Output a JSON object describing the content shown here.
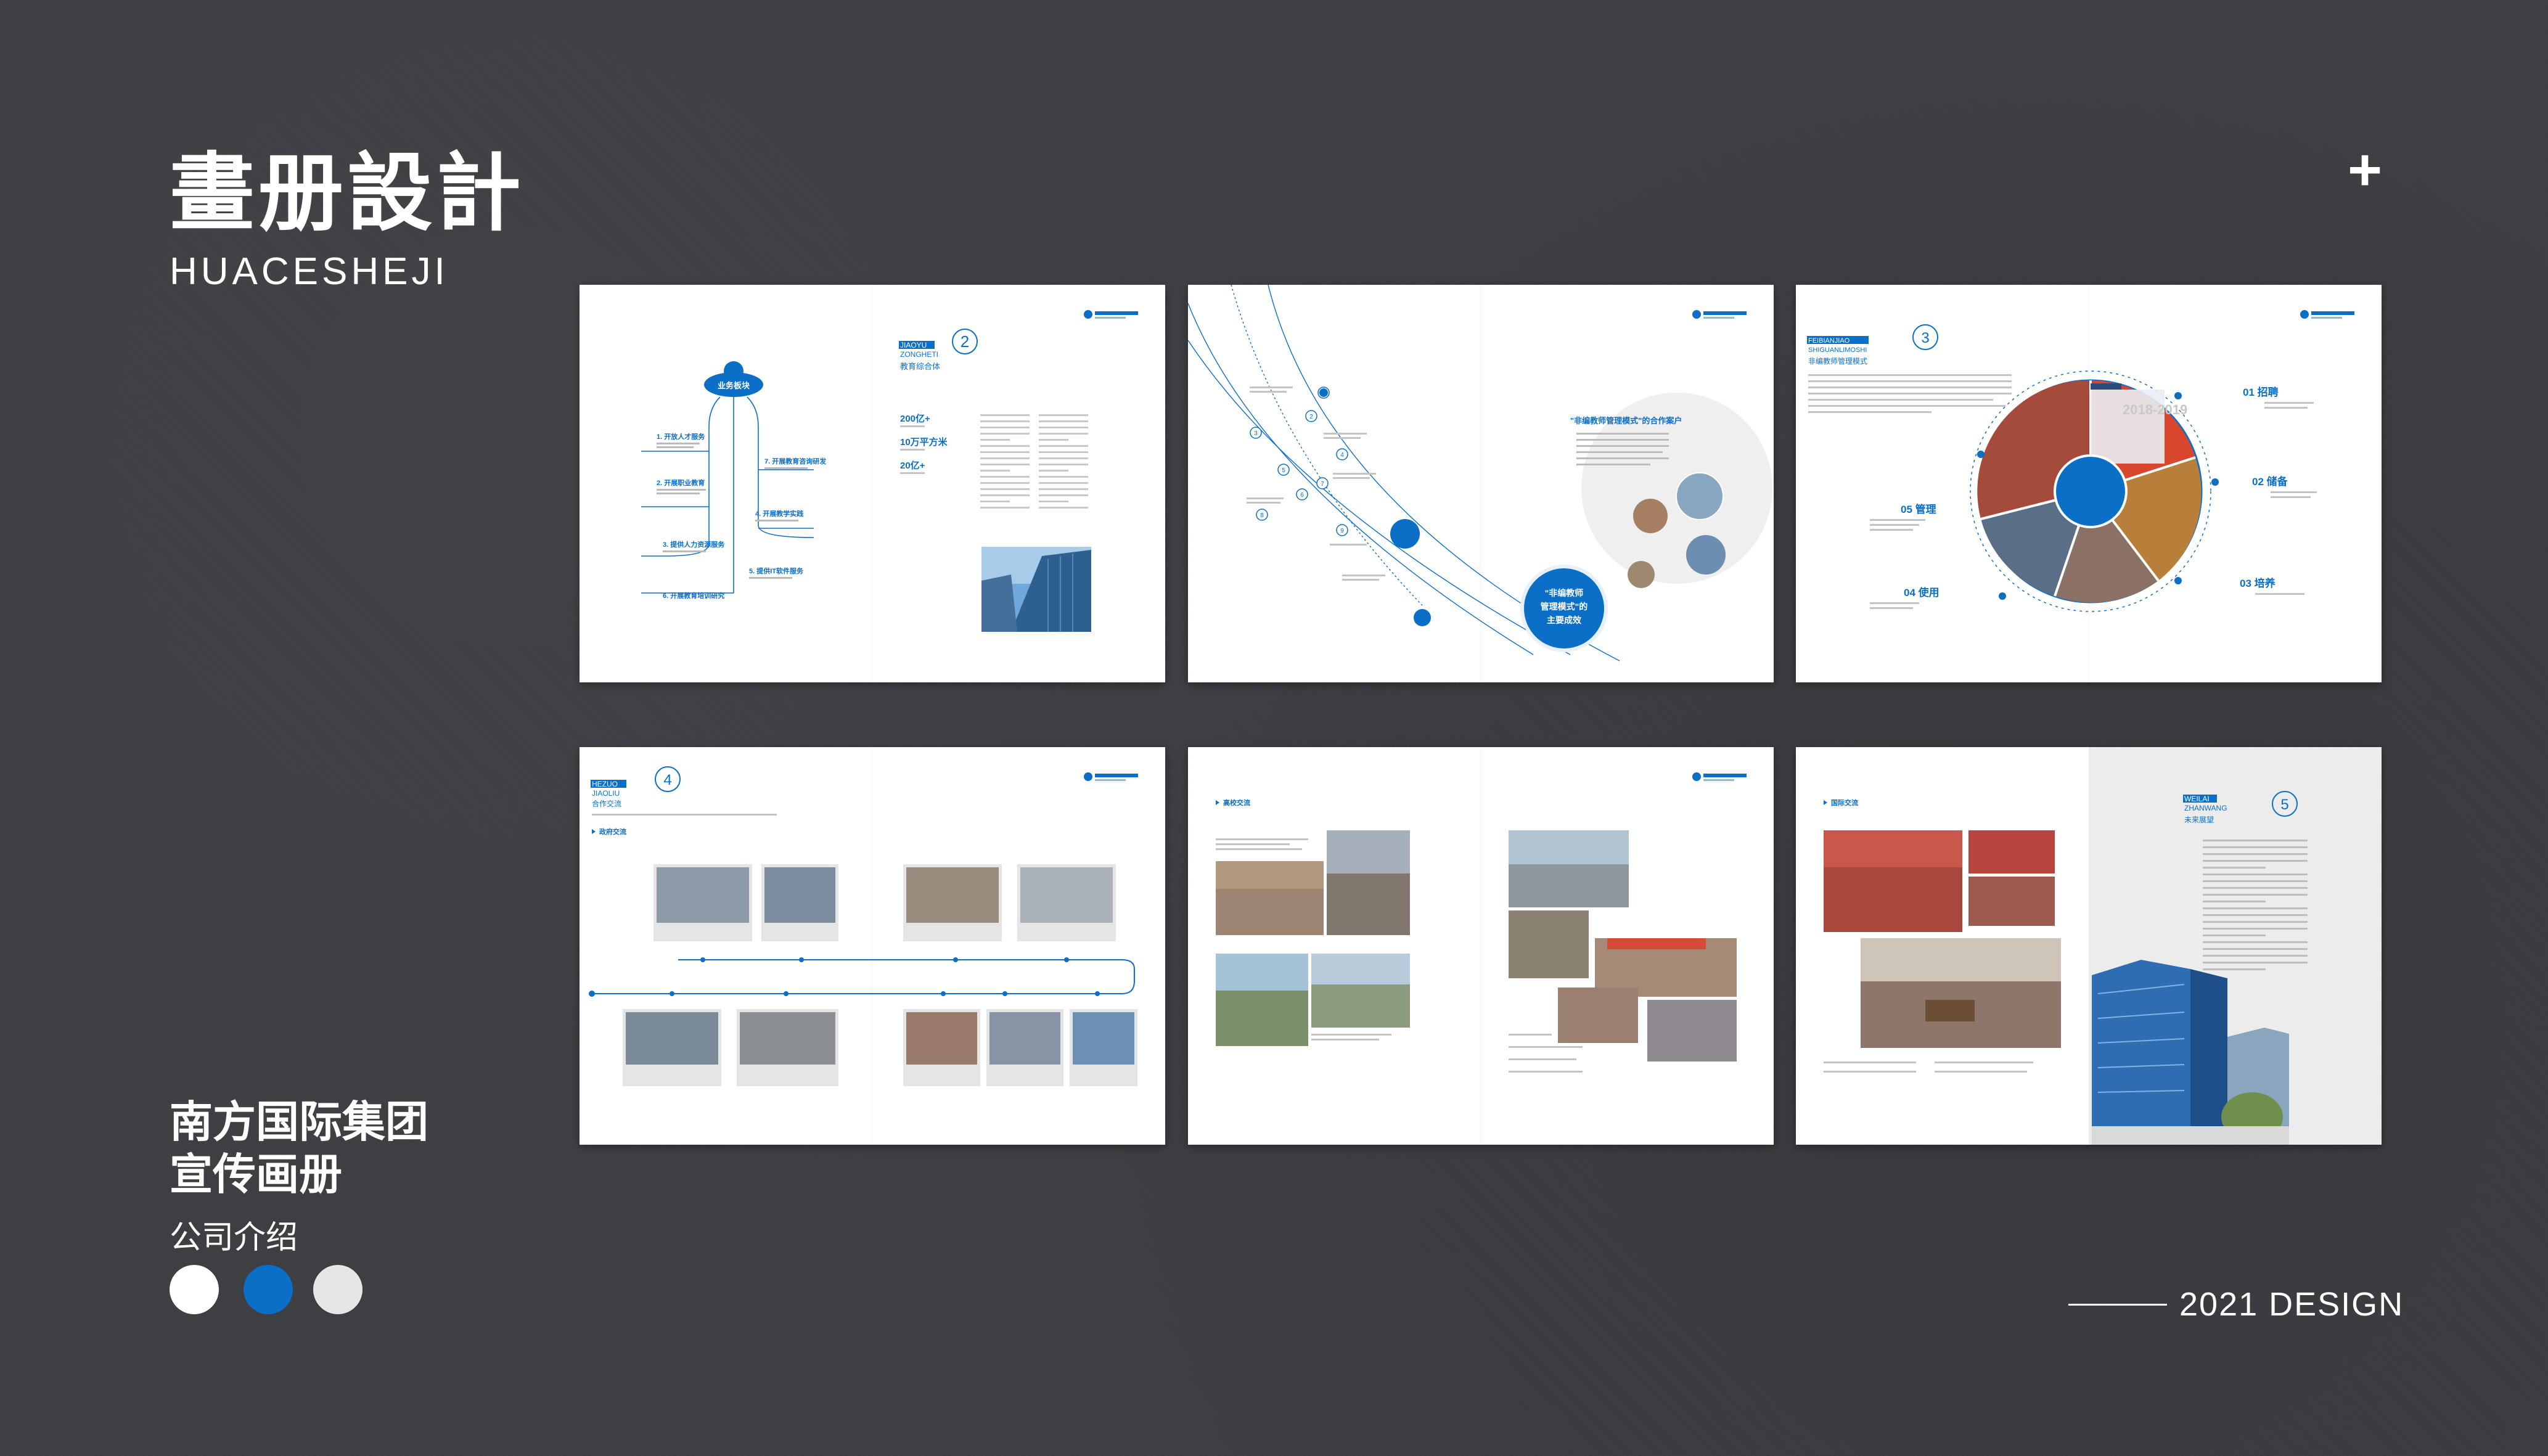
{
  "header": {
    "title_cn": "畫册設計",
    "title_en": "HUACESHEJI",
    "plus": "+"
  },
  "footer": {
    "company_line1": "南方国际集团",
    "company_line2": "宣传画册",
    "intro": "公司介绍",
    "year": "2021 DESIGN"
  },
  "swatches": [
    "#ffffff",
    "#0b6fc7",
    "#e6e6e6"
  ],
  "brand_color": "#0b6fc7",
  "pages": {
    "p1": {
      "section_pinyin1": "JIAOYU",
      "section_pinyin2": "ZONGHETI",
      "number": "2",
      "section_cn": "教育综合体",
      "bubble": "业务板块",
      "items": [
        "1. 开放人才服务",
        "2. 开展职业教育",
        "3. 提供人力资源服务",
        "4. 开展教学实践",
        "5. 提供IT软件服务",
        "6. 开展教育培训研究",
        "7. 开展教育咨询研发"
      ],
      "stats": [
        "200亿+",
        "10万平方米",
        "20亿+"
      ]
    },
    "p2": {
      "heading": "\"非编教师管理模式\"的合作案户",
      "badge_line1": "\"非编教师",
      "badge_line2": "管理模式\"的",
      "badge_line3": "主要成效",
      "numbers": [
        "1",
        "2",
        "3",
        "4",
        "5",
        "6",
        "7",
        "8",
        "9"
      ]
    },
    "p3": {
      "section_pinyin1": "FEIBIANJIAO",
      "section_pinyin2": "SHIGUANLIMOSHI",
      "number": "3",
      "section_cn": "非编教师管理模式",
      "labels": [
        "01 招聘",
        "02 储备",
        "03 培养",
        "04 使用",
        "05 管理"
      ],
      "banner_year": "2018-2019"
    },
    "p4": {
      "section_pinyin1": "HEZUO",
      "section_pinyin2": "JIAOLIU",
      "number": "4",
      "section_cn": "合作交流",
      "sub": "政府交流"
    },
    "p5": {
      "sub": "高校交流"
    },
    "p6": {
      "section_pinyin1": "WEILAI",
      "section_pinyin2": "ZHANWANG",
      "number": "5",
      "section_cn": "未来展望",
      "sub": "国际交流"
    }
  }
}
